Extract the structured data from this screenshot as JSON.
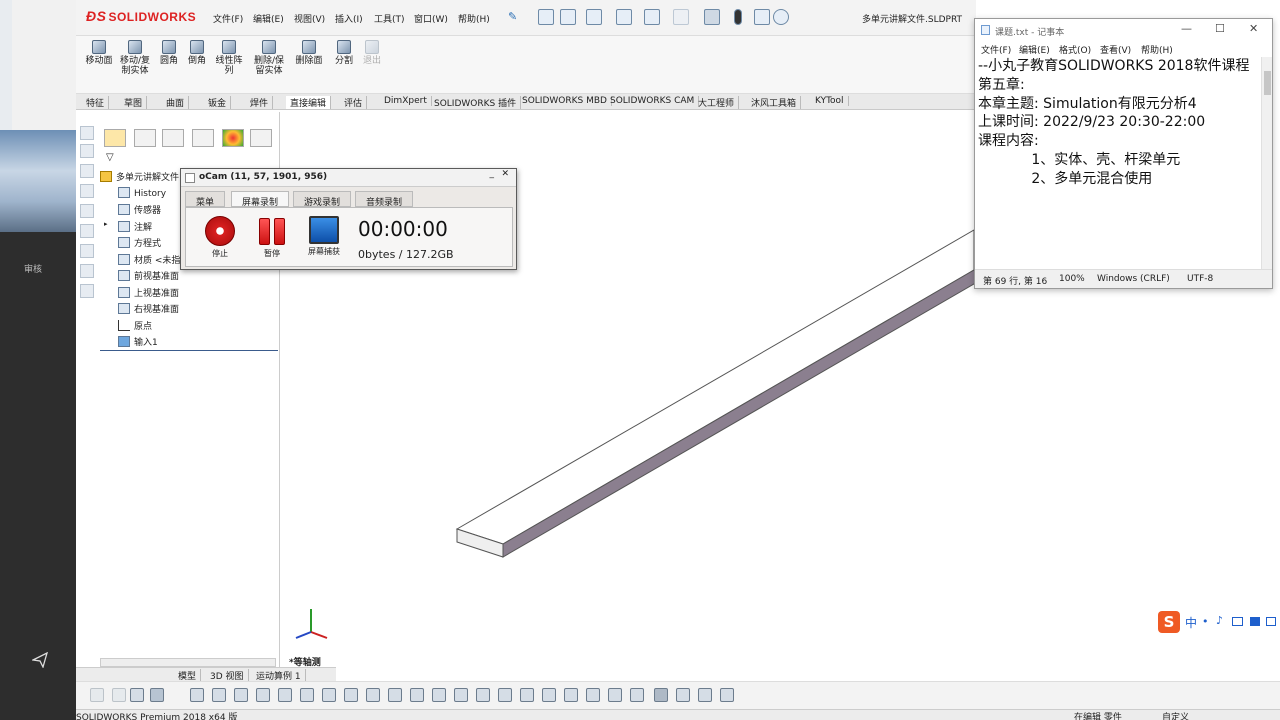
{
  "leftpane": {
    "review_label": "审核"
  },
  "app": {
    "logo_text": "SOLIDWORKS",
    "menus": [
      "文件(F)",
      "编辑(E)",
      "视图(V)",
      "插入(I)",
      "工具(T)",
      "窗口(W)",
      "帮助(H)"
    ],
    "document_title": "多单元讲解文件.SLDPRT"
  },
  "ribbon": {
    "buttons": [
      "移动面",
      "移动/复制实体",
      "圆角",
      "倒角",
      "线性阵列",
      "删除/保留实体",
      "删除面",
      "分割",
      "退出"
    ]
  },
  "command_tabs": [
    "特征",
    "草图",
    "曲面",
    "钣金",
    "焊件",
    "直接编辑",
    "评估",
    "DimXpert",
    "SOLIDWORKS 插件",
    "SOLIDWORKS MBD",
    "SOLIDWORKS CAM",
    "大工程师",
    "沐风工具箱",
    "KYTool"
  ],
  "tree": {
    "root": "多单元讲解文件",
    "items": [
      "History",
      "传感器",
      "注解",
      "方程式",
      "材质 <未指定>",
      "前视基准面",
      "上视基准面",
      "右视基准面",
      "原点",
      "输入1"
    ]
  },
  "view": {
    "orientation_label": "*等轴测"
  },
  "bottom_tabs": [
    "模型",
    "3D 视图",
    "运动算例 1"
  ],
  "status": {
    "left": "SOLIDWORKS Premium 2018 x64 版",
    "editing": "在编辑 零件",
    "custom": "自定义"
  },
  "ocam": {
    "title": "oCam (11, 57, 1901, 956)",
    "minimize": "_",
    "close": "✕",
    "tabs": [
      "菜单",
      "屏幕录制",
      "游戏录制",
      "音频录制"
    ],
    "active_tab": "屏幕录制",
    "buttons": [
      "停止",
      "暂停",
      "屏幕捕获"
    ],
    "time": "00:00:00",
    "size": "0bytes / 127.2GB"
  },
  "notepad": {
    "title": "课题.txt - 记事本",
    "menus": [
      "文件(F)",
      "编辑(E)",
      "格式(O)",
      "查看(V)",
      "帮助(H)"
    ],
    "lines": [
      "--小丸子教育SOLIDWORKS 2018软件课程",
      "第五章:",
      "",
      "本章主题: Simulation有限元分析4",
      "",
      "上课时间: 2022/9/23 20:30-22:00",
      "",
      "课程内容:",
      "            1、实体、壳、杆梁单元",
      "            2、多单元混合使用"
    ],
    "status": {
      "position": "第 69 行, 第 16",
      "zoom": "100%",
      "eol": "Windows (CRLF)",
      "encoding": "UTF-8"
    }
  },
  "ime": {
    "label": "中"
  }
}
